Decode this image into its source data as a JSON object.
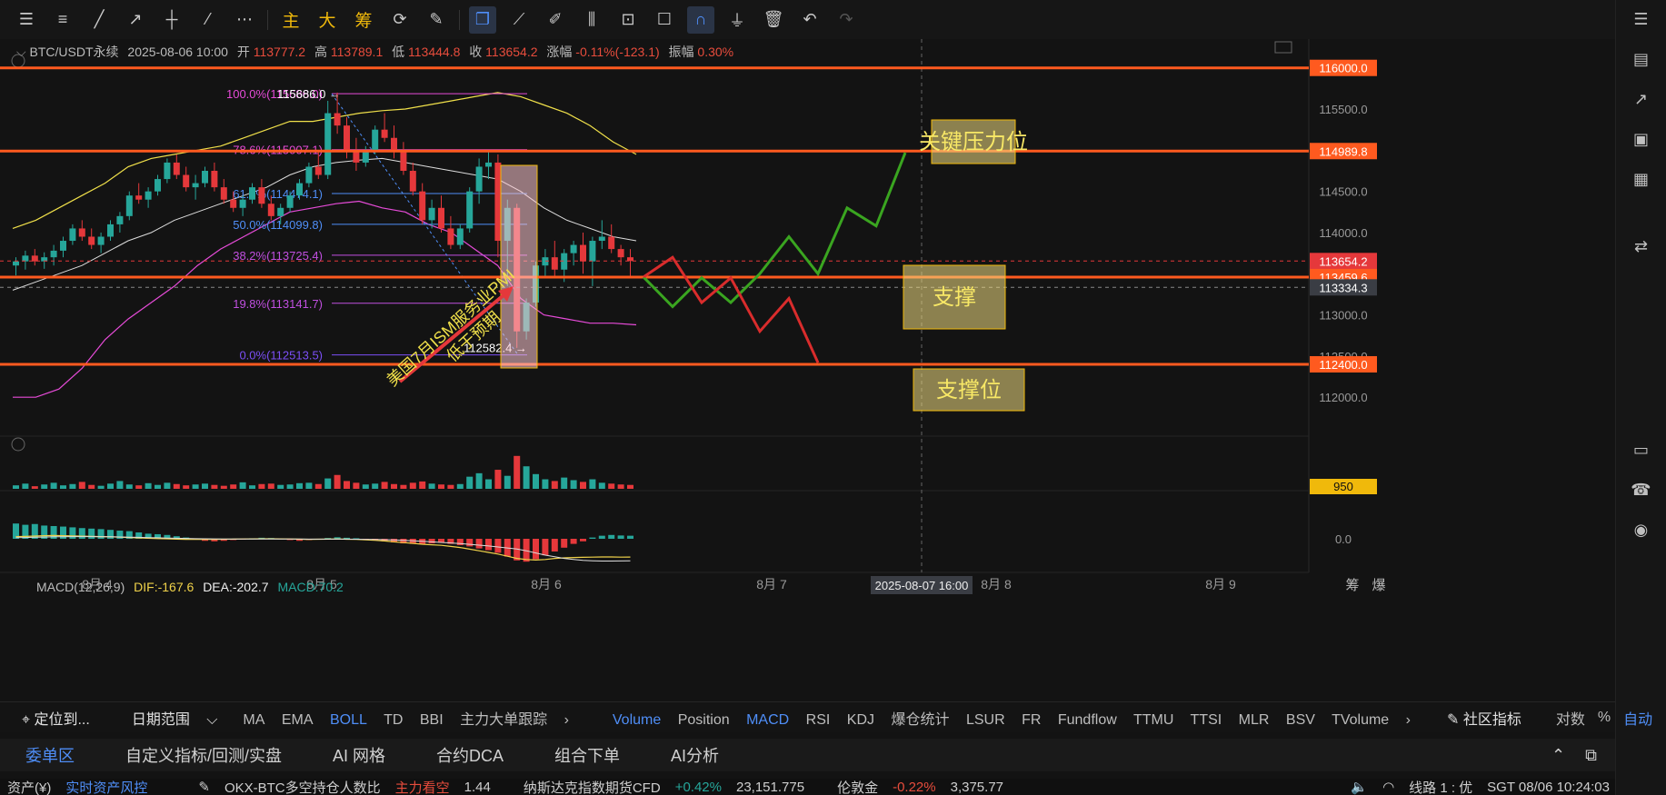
{
  "toolbar": {
    "icons": [
      "menu-icon",
      "indicator-list-icon",
      "trend-line-icon",
      "ray-icon",
      "horizontal-line-icon",
      "fib-icon",
      "more-icon"
    ],
    "main_label": "主",
    "big_label": "大",
    "chip_label": "筹"
  },
  "header": {
    "symbol": "BTC/USDT永续",
    "datetime": "2025-08-06 10:00",
    "open_label": "开",
    "open": "113777.2",
    "high_label": "高",
    "high": "113789.1",
    "low_label": "低",
    "low": "113444.8",
    "close_label": "收",
    "close": "113654.2",
    "change_label": "涨幅",
    "change": "-0.11%(-123.1)",
    "amp_label": "振幅",
    "amp": "0.30%"
  },
  "macd_header": {
    "name": "MACD(12,26,9)",
    "dif": "DIF:-167.6",
    "dea": "DEA:-202.7",
    "macd": "MACD:70.2"
  },
  "chart_data": {
    "type": "candlestick",
    "ylim": [
      111550,
      116350
    ],
    "y_ticks": [
      112000,
      112500,
      113000,
      113500,
      114000,
      114500,
      115000,
      115500
    ],
    "y_tick_labels": [
      "112000.0",
      "112500.0",
      "113000.0",
      "113500.0",
      "114000.0",
      "114500.0",
      "115000.0",
      "115500.0"
    ],
    "x_tick_labels": [
      "8月 4",
      "8月 5",
      "8月 6",
      "8月 7",
      "8月 8",
      "8月 9"
    ],
    "crosshair_time": "2025-08-07 16:00",
    "price_labels": [
      {
        "price": 116000.0,
        "label": "116000.0",
        "color": "#ff5a1f"
      },
      {
        "price": 114989.8,
        "label": "114989.8",
        "color": "#ff5a1f"
      },
      {
        "price": 113654.2,
        "label": "113654.2",
        "color": "#e5383b"
      },
      {
        "price": 113459.6,
        "label": "113459.6",
        "color": "#ff5a1f"
      },
      {
        "price": 113334.3,
        "label": "113334.3",
        "color": "#3a3d44"
      },
      {
        "price": 112400.0,
        "label": "112400.0",
        "color": "#ff5a1f"
      }
    ],
    "horizontal_levels": [
      116000.0,
      114989.8,
      113459.6,
      112400.0
    ],
    "fib_levels": [
      {
        "price": 115686.0,
        "label": "100.0%(115686.0)",
        "color": "#e64bd8"
      },
      {
        "price": 115007.1,
        "label": "78.6%(115007.1)",
        "color": "#e64bd8"
      },
      {
        "price": 114474.1,
        "label": "61.8%(114474.1)",
        "color": "#4f8ef7"
      },
      {
        "price": 114099.8,
        "label": "50.0%(114099.8)",
        "color": "#4f8ef7"
      },
      {
        "price": 113725.4,
        "label": "38.2%(113725.4)",
        "color": "#c04fe0"
      },
      {
        "price": 113141.7,
        "label": "19.8%(113141.7)",
        "color": "#c04fe0"
      },
      {
        "price": 112513.5,
        "label": "0.0%(112513.5)",
        "color": "#7c4ff7"
      }
    ],
    "peak_label": "115686.0",
    "trough_label": "112582.4",
    "candles": [
      [
        113600,
        113700,
        113480,
        113650
      ],
      [
        113650,
        113780,
        113550,
        113720
      ],
      [
        113720,
        113800,
        113600,
        113650
      ],
      [
        113650,
        113760,
        113560,
        113700
      ],
      [
        113700,
        113850,
        113600,
        113780
      ],
      [
        113780,
        113950,
        113700,
        113900
      ],
      [
        113900,
        114100,
        113850,
        114050
      ],
      [
        114050,
        114150,
        113900,
        113950
      ],
      [
        113950,
        114050,
        113800,
        113850
      ],
      [
        113850,
        114000,
        113750,
        113950
      ],
      [
        113950,
        114150,
        113900,
        114100
      ],
      [
        114100,
        114250,
        114000,
        114200
      ],
      [
        114200,
        114500,
        114150,
        114450
      ],
      [
        114450,
        114600,
        114350,
        114400
      ],
      [
        114400,
        114550,
        114300,
        114500
      ],
      [
        114500,
        114700,
        114450,
        114650
      ],
      [
        114650,
        114900,
        114600,
        114850
      ],
      [
        114850,
        114950,
        114650,
        114700
      ],
      [
        114700,
        114800,
        114500,
        114550
      ],
      [
        114550,
        114700,
        114400,
        114600
      ],
      [
        114600,
        114800,
        114550,
        114750
      ],
      [
        114750,
        114850,
        114500,
        114550
      ],
      [
        114550,
        114650,
        114350,
        114400
      ],
      [
        114400,
        114500,
        114250,
        114300
      ],
      [
        114300,
        114450,
        114200,
        114400
      ],
      [
        114400,
        114600,
        114350,
        114550
      ],
      [
        114550,
        114650,
        114300,
        114350
      ],
      [
        114350,
        114450,
        114150,
        114200
      ],
      [
        114200,
        114350,
        114100,
        114300
      ],
      [
        114300,
        114500,
        114250,
        114450
      ],
      [
        114450,
        114650,
        114400,
        114600
      ],
      [
        114600,
        114850,
        114550,
        114800
      ],
      [
        114800,
        115000,
        114650,
        114700
      ],
      [
        114700,
        115600,
        114650,
        115450
      ],
      [
        115450,
        115700,
        115200,
        115300
      ],
      [
        115300,
        115400,
        114900,
        115000
      ],
      [
        115000,
        115150,
        114750,
        114850
      ],
      [
        114850,
        115050,
        114800,
        115000
      ],
      [
        115000,
        115300,
        114950,
        115250
      ],
      [
        115250,
        115450,
        115100,
        115150
      ],
      [
        115150,
        115300,
        114900,
        115000
      ],
      [
        115000,
        115100,
        114700,
        114750
      ],
      [
        114750,
        114850,
        114450,
        114500
      ],
      [
        114500,
        114600,
        114100,
        114150
      ],
      [
        114150,
        114400,
        114050,
        114300
      ],
      [
        114300,
        114450,
        114000,
        114050
      ],
      [
        114050,
        114200,
        113800,
        113850
      ],
      [
        113850,
        114100,
        113800,
        114050
      ],
      [
        114050,
        114550,
        114000,
        114500
      ],
      [
        114500,
        114900,
        114350,
        114800
      ],
      [
        114800,
        115000,
        114650,
        114850
      ],
      [
        114850,
        114950,
        113700,
        113900
      ],
      [
        113900,
        114400,
        113350,
        114300
      ],
      [
        114300,
        114350,
        112600,
        112800
      ],
      [
        112800,
        113200,
        112700,
        113150
      ],
      [
        113150,
        113650,
        113100,
        113600
      ],
      [
        113600,
        113800,
        113450,
        113700
      ],
      [
        113700,
        113900,
        113450,
        113550
      ],
      [
        113550,
        113800,
        113400,
        113750
      ],
      [
        113750,
        113900,
        113600,
        113850
      ],
      [
        113850,
        114000,
        113500,
        113650
      ],
      [
        113650,
        113950,
        113350,
        113900
      ],
      [
        113900,
        114150,
        113800,
        113950
      ],
      [
        113950,
        114100,
        113750,
        113800
      ],
      [
        113800,
        113850,
        113600,
        113700
      ],
      [
        113700,
        113800,
        113450,
        113654
      ]
    ],
    "boll_upper": [
      114050,
      114150,
      114300,
      114450,
      114600,
      114800,
      114900,
      114950,
      115000,
      115050,
      115150,
      115250,
      115350,
      115350,
      115400,
      115450,
      115480,
      115500,
      115550,
      115600,
      115650,
      115700,
      115650,
      115550,
      115450,
      115300,
      115100,
      114950
    ],
    "boll_mid": [
      113300,
      113400,
      113500,
      113600,
      113750,
      113900,
      114000,
      114150,
      114250,
      114350,
      114450,
      114550,
      114700,
      114800,
      114850,
      114880,
      114900,
      114850,
      114800,
      114750,
      114700,
      114650,
      114500,
      114300,
      114150,
      114050,
      113950,
      113900
    ],
    "boll_lower": [
      112000,
      112000,
      112100,
      112350,
      112700,
      112950,
      113150,
      113350,
      113600,
      113800,
      113950,
      114100,
      114250,
      114300,
      114350,
      114380,
      114300,
      114250,
      114100,
      114000,
      113800,
      113600,
      113200,
      113000,
      112950,
      112900,
      112900,
      112880
    ],
    "annotation_arrow_text": [
      "美国7月ISM服务业PMI",
      "低于预期"
    ],
    "zones": [
      {
        "label": "关键压力位"
      },
      {
        "label": "支撑"
      },
      {
        "label": "支撑位"
      }
    ],
    "scenario_green": [
      [
        113459.6,
        0
      ],
      [
        113100,
        1
      ],
      [
        113450,
        2
      ],
      [
        113150,
        3
      ],
      [
        113500,
        4
      ],
      [
        113950,
        5
      ],
      [
        113500,
        6
      ],
      [
        114300,
        7
      ],
      [
        114080,
        8
      ],
      [
        114970,
        9
      ]
    ],
    "scenario_red": [
      [
        113459.6,
        0
      ],
      [
        113700,
        1
      ],
      [
        113150,
        2
      ],
      [
        113450,
        3
      ],
      [
        112800,
        4
      ],
      [
        113200,
        5
      ],
      [
        112420,
        6
      ]
    ],
    "volume_label": "950",
    "volume": [
      40,
      60,
      30,
      50,
      70,
      40,
      55,
      80,
      45,
      35,
      60,
      90,
      50,
      40,
      65,
      45,
      70,
      55,
      40,
      50,
      60,
      45,
      35,
      50,
      75,
      40,
      55,
      60,
      45,
      50,
      65,
      70,
      55,
      120,
      160,
      90,
      70,
      50,
      60,
      80,
      55,
      45,
      70,
      85,
      60,
      50,
      45,
      55,
      140,
      180,
      110,
      220,
      150,
      380,
      260,
      170,
      110,
      90,
      130,
      100,
      80,
      110,
      70,
      60,
      50,
      45
    ],
    "macd_zero_label": "0.0",
    "macd_hist": [
      60,
      55,
      58,
      52,
      50,
      48,
      45,
      42,
      40,
      38,
      35,
      32,
      30,
      25,
      20,
      18,
      15,
      10,
      5,
      -3,
      -8,
      -10,
      -8,
      -5,
      -3,
      2,
      4,
      3,
      -2,
      -5,
      -8,
      -5,
      -2,
      3,
      6,
      4,
      2,
      -3,
      -6,
      -10,
      -14,
      -18,
      -20,
      -22,
      -18,
      -15,
      -20,
      -25,
      -30,
      -38,
      -45,
      -55,
      -70,
      -85,
      -90,
      -80,
      -65,
      -50,
      -35,
      -20,
      -10,
      5,
      12,
      15,
      13,
      12
    ],
    "macd_dif": [
      20,
      22,
      25,
      28,
      30,
      28,
      26,
      24,
      22,
      20,
      18,
      15,
      12,
      8,
      5,
      2,
      0,
      -3,
      -5,
      -6,
      -6,
      -5,
      -4,
      -3,
      -2,
      -1,
      0,
      0,
      -1,
      -2,
      -4,
      -5,
      -4,
      -3,
      -2,
      -4,
      -6,
      -10,
      -14,
      -20,
      -28,
      -35,
      -42,
      -50,
      -55,
      -60,
      -70,
      -80,
      -95,
      -110,
      -125,
      -140,
      -160,
      -180,
      -190,
      -195,
      -190,
      -180,
      -175,
      -172,
      -170,
      -168,
      -167,
      -167,
      -168,
      -167.6
    ],
    "macd_dea": [
      10,
      12,
      14,
      16,
      18,
      19,
      20,
      20,
      20,
      19,
      18,
      17,
      15,
      13,
      11,
      9,
      7,
      5,
      3,
      1,
      0,
      -1,
      -2,
      -2,
      -2,
      -2,
      -2,
      -2,
      -2,
      -2,
      -2,
      -3,
      -3,
      -3,
      -3,
      -3,
      -4,
      -5,
      -6,
      -8,
      -11,
      -15,
      -19,
      -23,
      -28,
      -33,
      -38,
      -44,
      -51,
      -58,
      -66,
      -75,
      -84,
      -93,
      -110,
      -130,
      -150,
      -165,
      -180,
      -190,
      -198,
      -202,
      -204,
      -204,
      -203,
      -202.7
    ]
  },
  "indicators_left": {
    "locate": "定位到...",
    "range": "日期范围",
    "items": [
      "MA",
      "EMA",
      "BOLL",
      "TD",
      "BBI",
      "主力大单跟踪"
    ]
  },
  "indicators_right": {
    "items": [
      "Volume",
      "Position",
      "MACD",
      "RSI",
      "KDJ",
      "爆仓统计",
      "LSUR",
      "FR",
      "Fundflow",
      "TTMU",
      "TTSI",
      "MLR",
      "BSV",
      "TVolume"
    ],
    "community": "社区指标",
    "log": "对数",
    "pct": "%",
    "auto": "自动"
  },
  "tabs": [
    "委单区",
    "自定义指标/回测/实盘",
    "AI 网格",
    "合约DCA",
    "组合下单",
    "AI分析"
  ],
  "status": {
    "asset": "资产(¥)",
    "risk": "实时资产风控",
    "ratio_text": "OKX-BTC多空持仓人数比",
    "ratio_tag": "主力看空",
    "ratio_val": "1.44",
    "nasdaq": "纳斯达克指数期货CFD",
    "nasdaq_chg": "+0.42%",
    "nasdaq_val": "23,151.775",
    "gold": "伦敦金",
    "gold_chg": "-0.22%",
    "gold_val": "3,375.77",
    "line": "线路 1 : 优",
    "time": "SGT 08/06 10:24:03"
  },
  "right_side": {
    "corner_text_1": "筹",
    "corner_text_2": "爆"
  }
}
